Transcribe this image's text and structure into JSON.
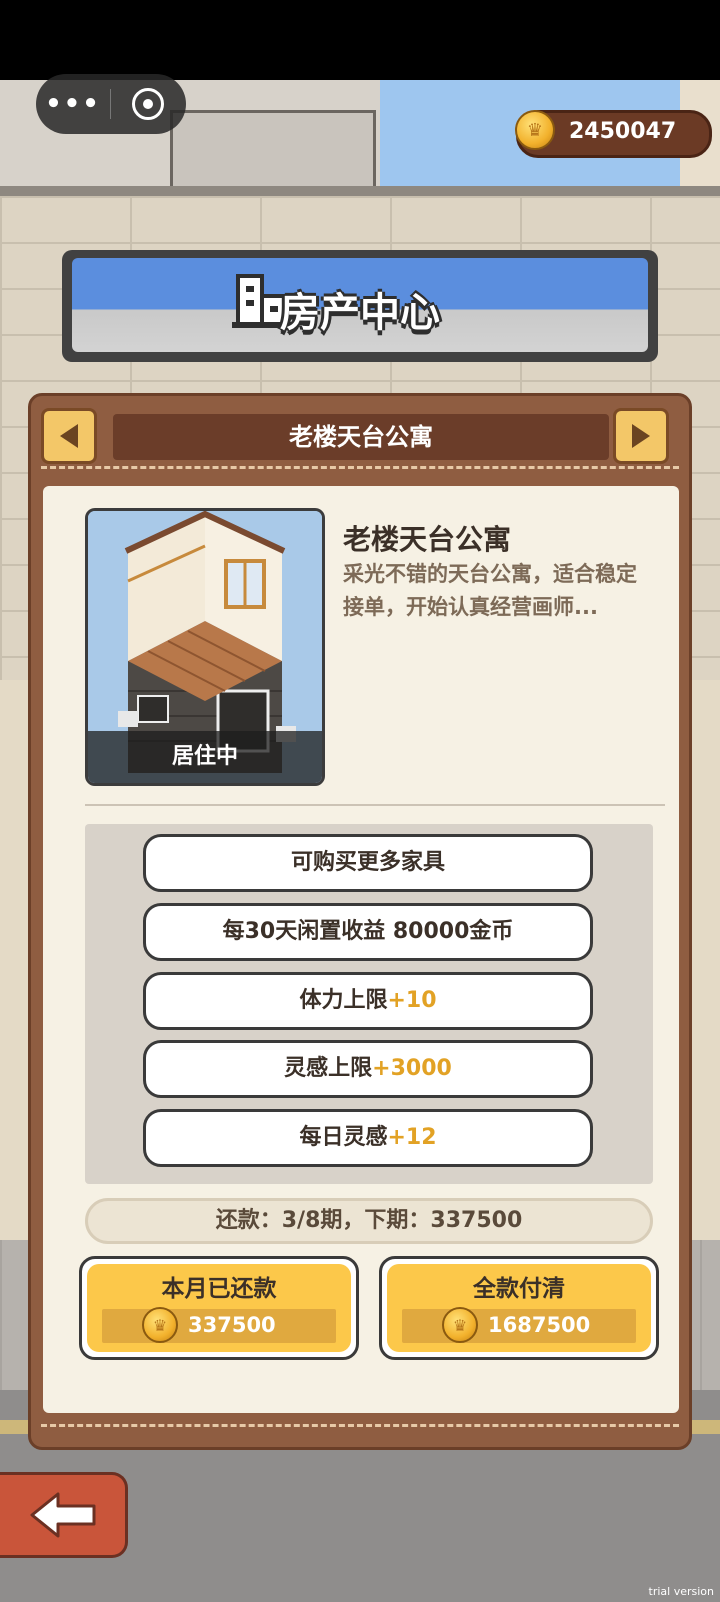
{
  "header": {
    "menu_dots": "•••",
    "coins": "2450047",
    "title": "房产中心"
  },
  "property": {
    "nav_name": "老楼天台公寓",
    "name": "老楼天台公寓",
    "description": "采光不错的天台公寓，适合稳定接单，开始认真经营画师...",
    "status": "居住中"
  },
  "features": [
    {
      "text": "可购买更多家具",
      "bonus": ""
    },
    {
      "text": "每30天闲置收益 80000金币",
      "bonus": ""
    },
    {
      "text": "体力上限",
      "bonus": "+10"
    },
    {
      "text": "灵感上限",
      "bonus": "+3000"
    },
    {
      "text": "每日灵感",
      "bonus": "+12"
    }
  ],
  "payment": {
    "info": "还款：3/8期，下期：337500",
    "monthly": {
      "label": "本月已还款",
      "amount": "337500"
    },
    "full": {
      "label": "全款付清",
      "amount": "1687500"
    }
  },
  "watermark": "trial version",
  "colors": {
    "panel_brown": "#8f5d41",
    "button_yellow": "#fcc84a",
    "bonus_orange": "#e2a225",
    "banner_blue": "#5b8ede",
    "back_red": "#c9553a"
  }
}
